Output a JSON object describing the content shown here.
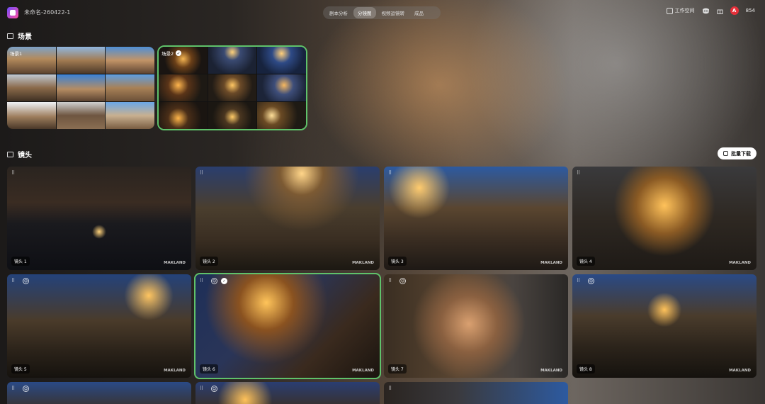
{
  "header": {
    "project_name": "未命名-260422-1",
    "tabs": [
      {
        "label": "剧本分析",
        "active": false
      },
      {
        "label": "分镜图",
        "active": true
      },
      {
        "label": "视频运镜转",
        "active": false
      },
      {
        "label": "成品",
        "active": false
      }
    ],
    "workspace_label": "工作空间",
    "credits": "854",
    "avatar_letter": "A"
  },
  "scenes_section": {
    "title": "场景",
    "scenes": [
      {
        "label": "场景1",
        "selected": false
      },
      {
        "label": "场景2",
        "selected": true
      }
    ]
  },
  "shots_section": {
    "title": "镜头",
    "download_label": "批量下载",
    "watermark": "MAKLAND",
    "shots": [
      {
        "label": "镜头 1",
        "selected": false,
        "badge": "",
        "theme": "reflection"
      },
      {
        "label": "镜头 2",
        "selected": false,
        "badge": "",
        "theme": "couple-alley"
      },
      {
        "label": "镜头 3",
        "selected": false,
        "badge": "",
        "theme": "dance-street"
      },
      {
        "label": "镜头 4",
        "selected": false,
        "badge": "",
        "theme": "glow-couple"
      },
      {
        "label": "镜头 5",
        "selected": false,
        "badge": "face",
        "theme": "jump-street"
      },
      {
        "label": "镜头 6",
        "selected": true,
        "badge": "face-check",
        "theme": "hands-bokeh"
      },
      {
        "label": "镜头 7",
        "selected": false,
        "badge": "face",
        "theme": "portrait"
      },
      {
        "label": "镜头 8",
        "selected": false,
        "badge": "face",
        "theme": "lift-street"
      },
      {
        "label": "",
        "selected": false,
        "badge": "face",
        "theme": "partial-a"
      },
      {
        "label": "",
        "selected": false,
        "badge": "face",
        "theme": "partial-b"
      },
      {
        "label": "",
        "selected": false,
        "badge": "",
        "theme": "partial-c"
      }
    ]
  }
}
